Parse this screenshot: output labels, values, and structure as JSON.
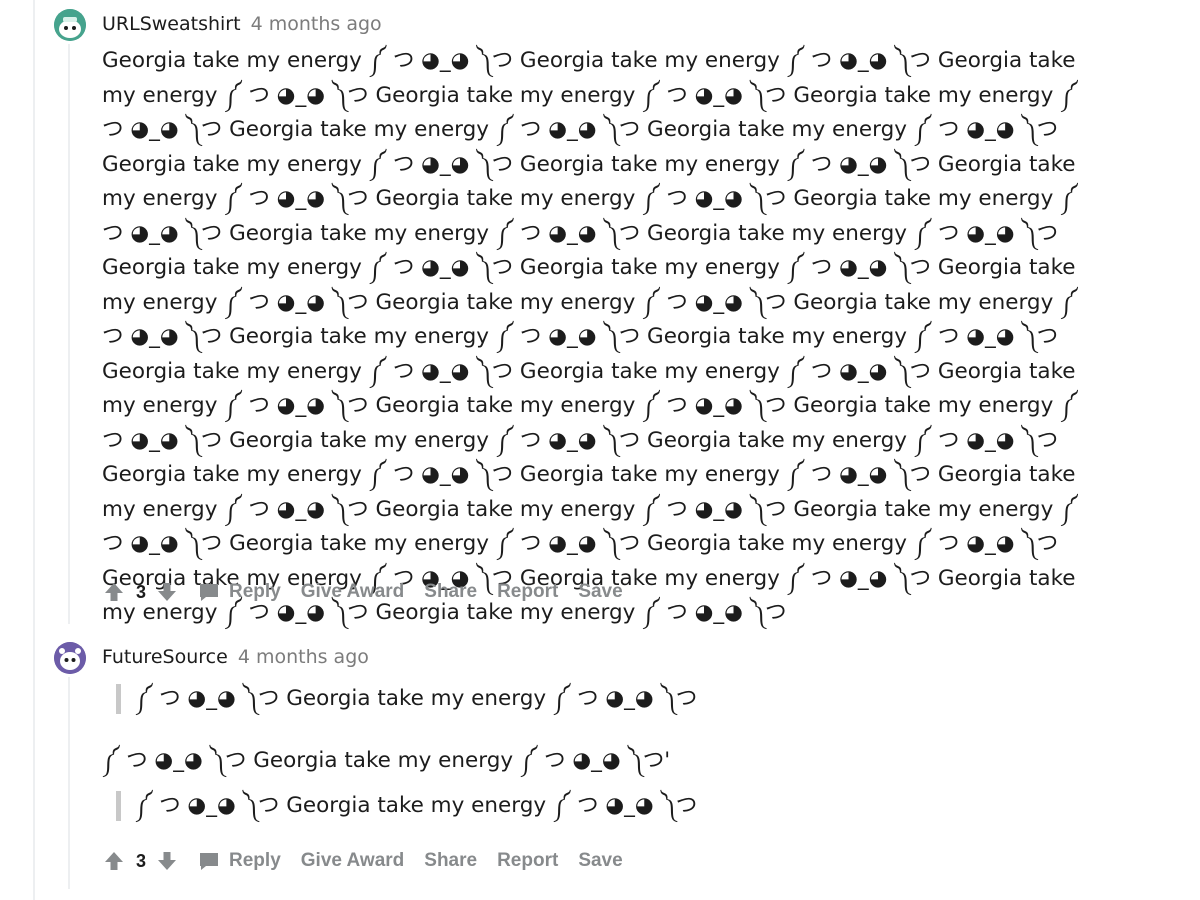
{
  "comments": [
    {
      "author": "URLSweatshirt",
      "time": "4 months ago",
      "body": "Georgia take my energy ༼ つ ◕_◕ ༽つ Georgia take my energy ༼ つ ◕_◕ ༽つ Georgia take my energy ༼ つ ◕_◕ ༽つ Georgia take my energy ༼ つ ◕_◕ ༽つ Georgia take my energy ༼ つ ◕_◕ ༽つ Georgia take my energy ༼ つ ◕_◕ ༽つ Georgia take my energy ༼ つ ◕_◕ ༽つ Georgia take my energy ༼ つ ◕_◕ ༽つ Georgia take my energy ༼ つ ◕_◕ ༽つ Georgia take my energy ༼ つ ◕_◕ ༽つ Georgia take my energy ༼ つ ◕_◕ ༽つ Georgia take my energy ༼ つ ◕_◕ ༽つ Georgia take my energy ༼ つ ◕_◕ ༽つ Georgia take my energy ༼ つ ◕_◕ ༽つ Georgia take my energy ༼ つ ◕_◕ ༽つ Georgia take my energy ༼ つ ◕_◕ ༽つ Georgia take my energy ༼ つ ◕_◕ ༽つ Georgia take my energy ༼ つ ◕_◕ ༽つ Georgia take my energy ༼ つ ◕_◕ ༽つ Georgia take my energy ༼ つ ◕_◕ ༽つ Georgia take my energy ༼ つ ◕_◕ ༽つ Georgia take my energy ༼ つ ◕_◕ ༽つ Georgia take my energy ༼ つ ◕_◕ ༽つ Georgia take my energy ༼ つ ◕_◕ ༽つ Georgia take my energy ༼ つ ◕_◕ ༽つ Georgia take my energy ༼ つ ◕_◕ ༽つ Georgia take my energy ༼ つ ◕_◕ ༽つ Georgia take my energy ༼ つ ◕_◕ ༽つ Georgia take my energy ༼ つ ◕_◕ ༽つ Georgia take my energy ༼ つ ◕_◕ ༽つ Georgia take my energy ༼ つ ◕_◕ ༽つ Georgia take my energy ༼ つ ◕_◕ ༽つ Georgia take my energy ༼ つ ◕_◕ ༽つ Georgia take my energy ༼ つ ◕_◕ ༽つ Georgia take my energy ༼ つ ◕_◕ ༽つ Georgia take my energy ༼ つ ◕_◕ ༽つ Georgia take my energy ༼ つ ◕_◕ ༽つ Georgia take my energy ༼ つ ◕_◕ ༽つ Georgia take my energy ༼ つ ◕_◕ ༽つ",
      "score": "3",
      "actions": {
        "reply": "Reply",
        "award": "Give Award",
        "share": "Share",
        "report": "Report",
        "save": "Save"
      }
    },
    {
      "author": "FutureSource",
      "time": "4 months ago",
      "quote1": "༼ つ ◕_◕ ༽つ Georgia take my energy ༼ つ ◕_◕ ༽つ",
      "plain": "༼ つ ◕_◕ ༽つ Georgia take my energy ༼ つ ◕_◕ ༽つ'",
      "quote2": "༼ つ ◕_◕ ༽つ Georgia take my energy ༼ つ ◕_◕ ༽つ",
      "score": "3",
      "actions": {
        "reply": "Reply",
        "award": "Give Award",
        "share": "Share",
        "report": "Report",
        "save": "Save"
      }
    }
  ]
}
